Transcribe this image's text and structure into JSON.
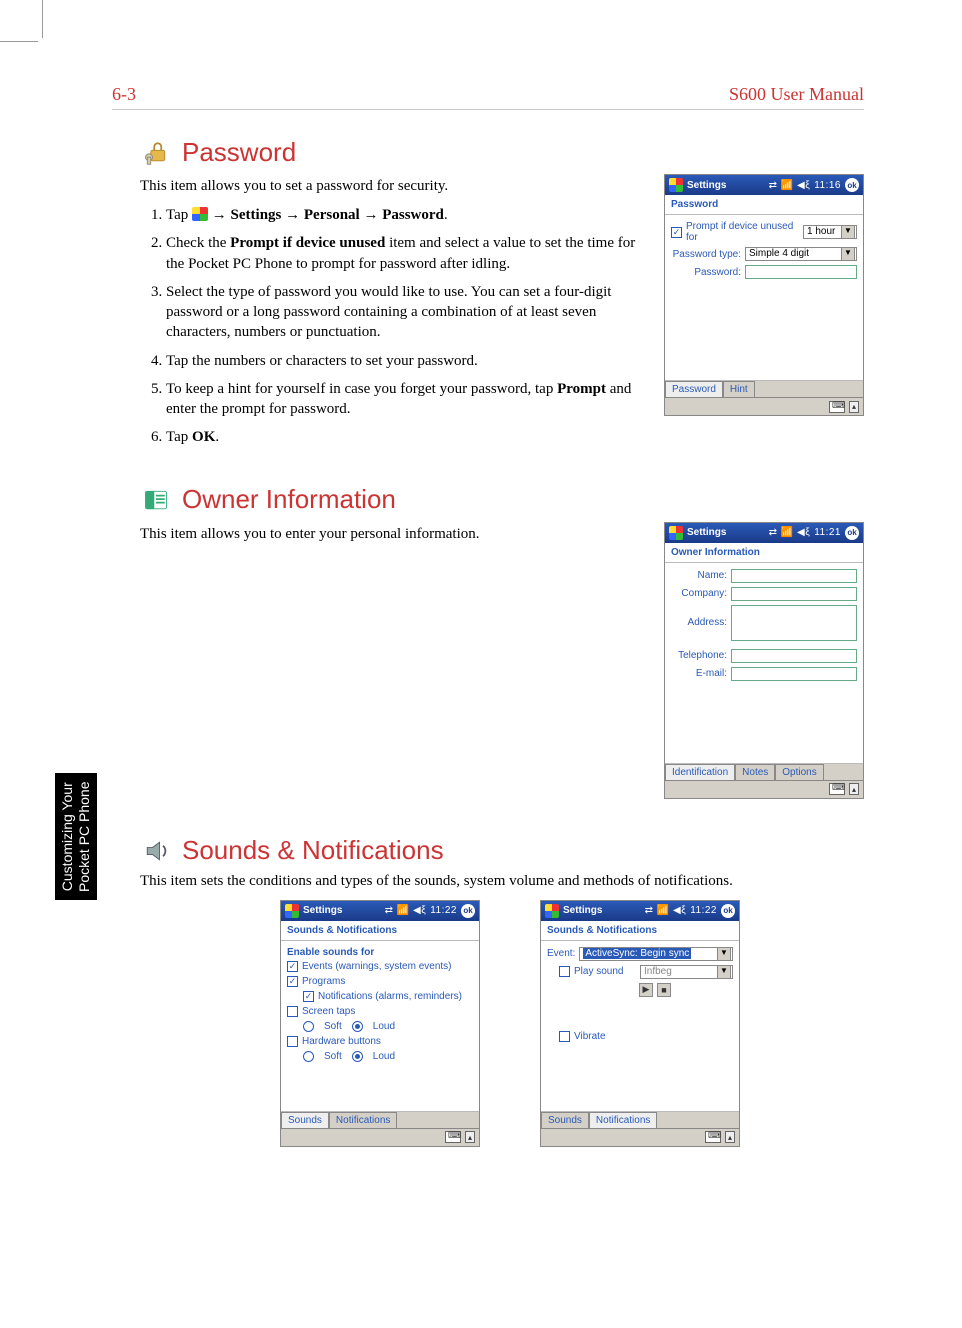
{
  "header": {
    "page_no": "6-3",
    "doc_title": "S600 User Manual"
  },
  "side_tab": {
    "line1": "Customizing Your",
    "line2": "Pocket PC Phone"
  },
  "password": {
    "title": "Password",
    "intro": "This item allows you to set a password for security.",
    "steps": {
      "s1_a": "Tap ",
      "s1_b": " → ",
      "s1_settings": "Settings",
      "s1_c": " → ",
      "s1_personal": "Personal",
      "s1_d": " → ",
      "s1_password": "Password",
      "s1_e": ".",
      "s2_a": "Check the ",
      "s2_bold": "Prompt if device unused",
      "s2_b": " item and select a value to set the time for the Pocket PC Phone to prompt for password after idling.",
      "s3": "Select the type of password you would like to use. You can set a four-digit password or a long password containing a combination of at least seven characters, numbers or punctuation.",
      "s4": "Tap the numbers or characters to set your password.",
      "s5_a": "To keep a hint for yourself in case you forget your password, tap ",
      "s5_bold": "Prompt",
      "s5_b": " and enter the prompt for password.",
      "s6_a": "Tap ",
      "s6_bold": "OK",
      "s6_b": "."
    },
    "shot": {
      "title": "Settings",
      "clock": "11:16",
      "ok": "ok",
      "page": "Password",
      "prompt_ck_label": "Prompt if device unused for",
      "prompt_dd": "1 hour",
      "type_lbl": "Password type:",
      "type_dd": "Simple 4 digit",
      "password_lbl": "Password:",
      "tab_password": "Password",
      "tab_hint": "Hint"
    }
  },
  "owner": {
    "title": "Owner Information",
    "intro": "This item allows you to enter your personal information.",
    "shot": {
      "title": "Settings",
      "clock": "11:21",
      "ok": "ok",
      "page": "Owner Information",
      "f_name": "Name:",
      "f_company": "Company:",
      "f_address": "Address:",
      "f_phone": "Telephone:",
      "f_email": "E-mail:",
      "tab_id": "Identification",
      "tab_notes": "Notes",
      "tab_options": "Options"
    }
  },
  "sounds": {
    "title": "Sounds & Notifications",
    "intro": "This item sets the conditions and types of the sounds, system volume and methods of notifications.",
    "shot1": {
      "title": "Settings",
      "clock": "11:22",
      "ok": "ok",
      "page": "Sounds & Notifications",
      "hd": "Enable sounds for",
      "ck_events": "Events (warnings, system events)",
      "ck_programs": "Programs",
      "ck_notifs": "Notifications (alarms, reminders)",
      "ck_screen": "Screen taps",
      "r_soft1": "Soft",
      "r_loud1": "Loud",
      "ck_hw": "Hardware buttons",
      "r_soft2": "Soft",
      "r_loud2": "Loud",
      "tab_sounds": "Sounds",
      "tab_notifs": "Notifications"
    },
    "shot2": {
      "title": "Settings",
      "clock": "11:22",
      "ok": "ok",
      "page": "Sounds & Notifications",
      "event_lbl": "Event:",
      "event_dd": "ActiveSync: Begin sync",
      "play_lbl": "Play sound",
      "play_dd": "Infbeg",
      "vibrate_lbl": "Vibrate",
      "play_icon": "▶",
      "stop_icon": "■",
      "tab_sounds": "Sounds",
      "tab_notifs": "Notifications"
    }
  }
}
